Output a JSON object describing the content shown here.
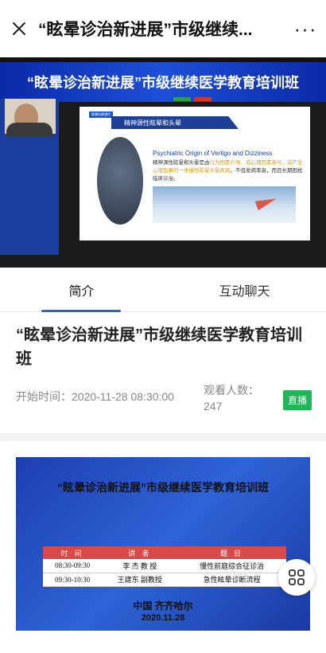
{
  "topbar": {
    "close_icon": "close-icon",
    "title": "“眩晕诊治新进展”市级继续...",
    "more_label": "···"
  },
  "video": {
    "banner_text": "“眩晕诊治新进展”市级继续医学教育培训班",
    "indicator_colors": [
      "#2ea043",
      "#d9342b"
    ],
    "slide": {
      "tag": "眩晕科普课件",
      "header": "精神源性眩晕和头晕",
      "english_title": "Psychiatric Origin of Vertigo and Dizziness",
      "text_prefix": "精神源性眩晕和头晕是由",
      "text_highlight": "行为因素介导、或心理因素参与、或产生心理后果的一类慢性眩晕头晕疾病",
      "text_suffix": "，不但发病率高，而且长期困扰临床诊治。"
    }
  },
  "tabs": [
    {
      "label": "简介",
      "active": true
    },
    {
      "label": "互动聊天",
      "active": false
    }
  ],
  "info": {
    "title": "“眩晕诊治新进展”市级继续医学教育培训班",
    "start_time": "开始时间：2020-11-28 08:30:00",
    "viewers_label": "观看人数：",
    "viewers_count": "247",
    "live_badge": "直播"
  },
  "poster": {
    "title": "“眩晕诊治新进展”市级继续医学教育培训班",
    "headers": [
      "时  间",
      "讲  者",
      "题  目"
    ],
    "rows": [
      [
        "08:30-09:30",
        "李  杰  教  授",
        "慢性前庭综合征诊治"
      ],
      [
        "09:30-10:30",
        "王建东 副教授",
        "急性眩晕诊断流程"
      ]
    ],
    "place": "中国   齐齐哈尔",
    "date": "2020.11.28"
  },
  "colors": {
    "accent": "#2563d9",
    "live": "#23b35a",
    "banner": "#1e4fd8",
    "table_header": "#d84a4a"
  },
  "float_button_icon": "grid-menu-icon"
}
